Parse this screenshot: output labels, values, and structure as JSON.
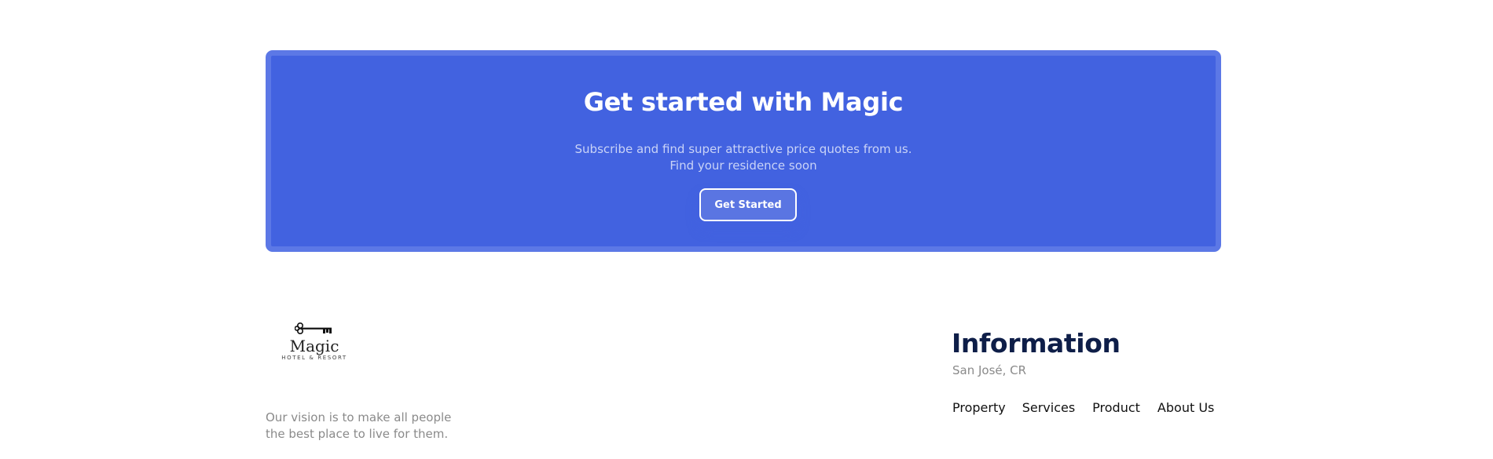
{
  "cta": {
    "title": "Get started with Magic",
    "subtitle_line1": "Subscribe and find super attractive price quotes from us.",
    "subtitle_line2": "Find your residence soon",
    "button_label": "Get Started",
    "background_color": "#4262e0"
  },
  "footer": {
    "logo": {
      "icon": "key-icon",
      "name": "Magic",
      "tagline": "HOTEL & RESORT"
    },
    "vision_line1": "Our vision is to make all people",
    "vision_line2": "the best place to live for them.",
    "information": {
      "title": "Information",
      "location": "San José, CR"
    },
    "nav": [
      {
        "label": "Property"
      },
      {
        "label": "Services"
      },
      {
        "label": "Product"
      },
      {
        "label": "About Us"
      }
    ]
  }
}
